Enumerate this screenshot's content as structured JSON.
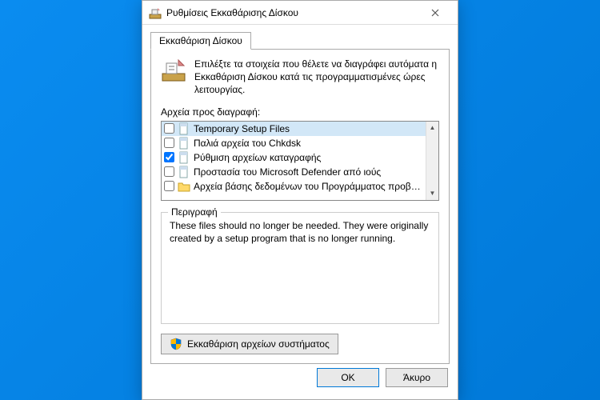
{
  "window": {
    "title": "Ρυθμίσεις Εκκαθάρισης Δίσκου"
  },
  "tab": {
    "label": "Εκκαθάριση Δίσκου"
  },
  "intro": {
    "text": "Επιλέξτε τα στοιχεία που θέλετε να διαγράφει αυτόματα η Εκκαθάριση Δίσκου κατά τις προγραμματισμένες ώρες λειτουργίας."
  },
  "list": {
    "label": "Αρχεία προς διαγραφή:",
    "items": [
      {
        "label": "Temporary Setup Files",
        "checked": false,
        "selected": true,
        "icon": "file-icon"
      },
      {
        "label": "Παλιά αρχεία του Chkdsk",
        "checked": false,
        "selected": false,
        "icon": "file-icon"
      },
      {
        "label": "Ρύθμιση αρχείων καταγραφής",
        "checked": true,
        "selected": false,
        "icon": "file-icon"
      },
      {
        "label": "Προστασία του Microsoft Defender από ιούς",
        "checked": false,
        "selected": false,
        "icon": "file-icon"
      },
      {
        "label": "Αρχεία βάσης δεδομένων του Προγράμματος προβο...",
        "checked": false,
        "selected": false,
        "icon": "folder-icon"
      }
    ]
  },
  "description": {
    "legend": "Περιγραφή",
    "text": "These files should no longer be needed. They were originally created by a setup program that is no longer running."
  },
  "buttons": {
    "system_files": "Εκκαθάριση αρχείων συστήματος",
    "ok": "OK",
    "cancel": "Άκυρο"
  }
}
